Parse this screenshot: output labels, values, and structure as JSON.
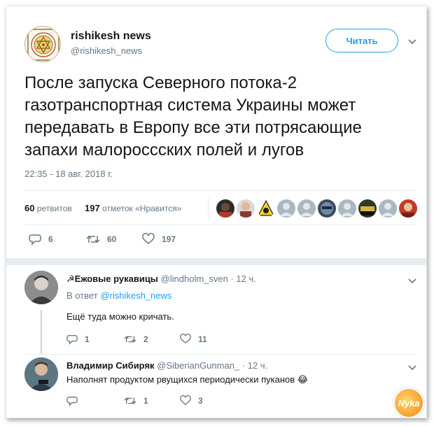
{
  "tweet": {
    "author_name": "rishikesh news",
    "author_handle": "@rishikesh_news",
    "follow_label": "Читать",
    "text_lines": [
      "После запуска Северного потока-2",
      "газотранспортная система Украины может",
      "передавать в Европу все эти потрясающие",
      "запахи малороссских полей и лугов"
    ],
    "timestamp": "22:35 - 18 авг. 2018 г.",
    "retweets_count": "60",
    "retweets_label": "ретвитов",
    "likes_count": "197",
    "likes_label": "отметок «Нравится»",
    "actions": {
      "replies": "6",
      "retweets": "60",
      "likes": "197"
    }
  },
  "replies": [
    {
      "name": "☭Ежовые рукавицы",
      "handle": "@lindholm_sven",
      "time": "· 12 ч.",
      "reply_to_prefix": "В ответ",
      "reply_to_mention": "@rishikesh_news",
      "text": "Ещё туда можно кричать.",
      "counts": {
        "replies": "1",
        "retweets": "2",
        "likes": "11"
      }
    },
    {
      "name": "Владимир Сибиряк",
      "handle": "@SiberianGunman_",
      "time": "· 12 ч.",
      "text": "Наполнят продуктом рвущихся периодически пуканов 😂",
      "counts": {
        "replies": "",
        "retweets": "1",
        "likes": "3"
      }
    }
  ],
  "watermark": "Nyka",
  "colors": {
    "accent": "#1da1f2",
    "muted": "#657786",
    "text": "#14171a",
    "border": "#e6ecf0"
  }
}
